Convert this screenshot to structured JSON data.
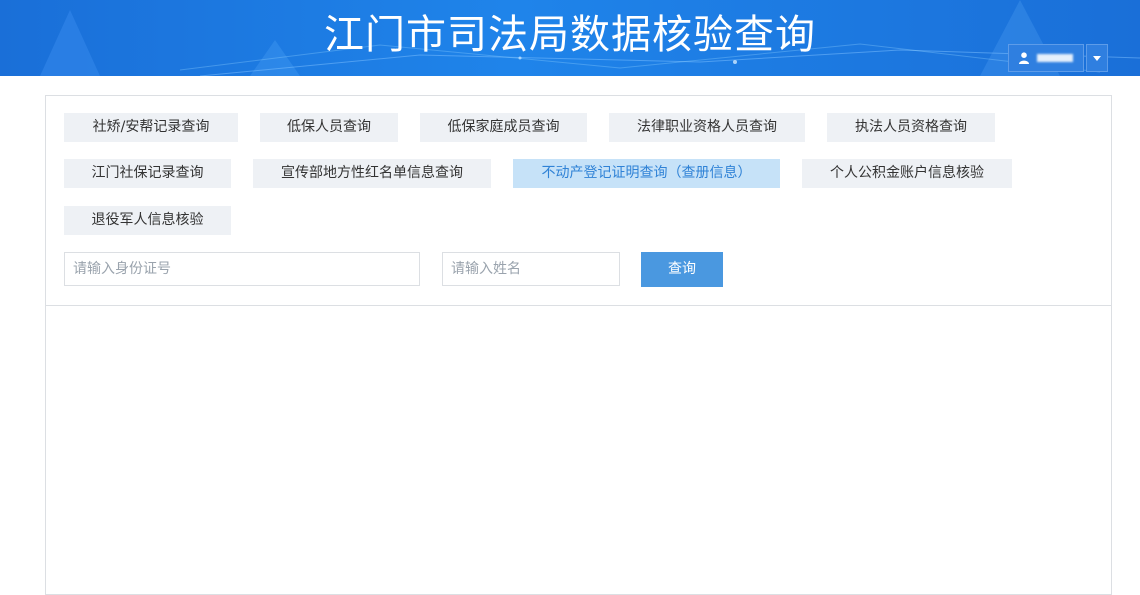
{
  "header": {
    "title": "江门市司法局数据核验查询",
    "background_color": "#1a6fd8"
  },
  "user": {
    "icon": "user-icon",
    "dropdown_icon": "caret-down-icon"
  },
  "query_types": [
    {
      "label": "社矫/安帮记录查询",
      "active": false
    },
    {
      "label": "低保人员查询",
      "active": false
    },
    {
      "label": "低保家庭成员查询",
      "active": false
    },
    {
      "label": "法律职业资格人员查询",
      "active": false
    },
    {
      "label": "执法人员资格查询",
      "active": false
    },
    {
      "label": "江门社保记录查询",
      "active": false
    },
    {
      "label": "宣传部地方性红名单信息查询",
      "active": false
    },
    {
      "label": "不动产登记证明查询（查册信息）",
      "active": true
    },
    {
      "label": "个人公积金账户信息核验",
      "active": false
    },
    {
      "label": "退役军人信息核验",
      "active": false
    }
  ],
  "form": {
    "id_placeholder": "请输入身份证号",
    "id_value": "",
    "name_placeholder": "请输入姓名",
    "name_value": "",
    "submit_label": "查询"
  },
  "colors": {
    "active_bg": "#c6e2f8",
    "active_text": "#2f82d6",
    "button_bg": "#eef1f5",
    "submit_bg": "#4a98e0"
  }
}
